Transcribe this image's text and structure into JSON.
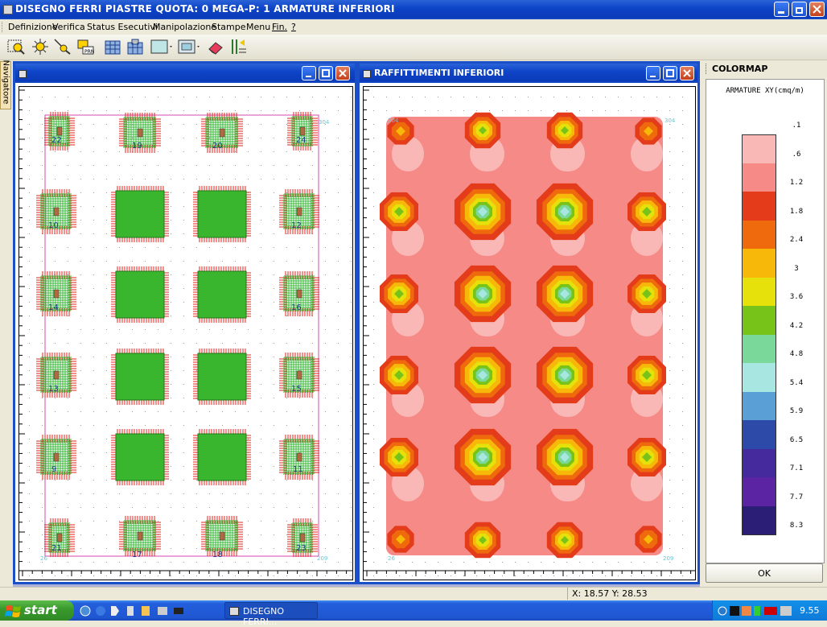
{
  "window": {
    "title": "DISEGNO FERRI PIASTRE QUOTA: 0 MEGA-P: 1 ARMATURE INFERIORI"
  },
  "menu": [
    "Definizione",
    "Verifica",
    "Status Esecutivi",
    "Manipolazione",
    "Stampe",
    "Menu",
    "Fin.",
    "?"
  ],
  "toolbar_icons": [
    "select-rect-icon",
    "select-point-icon",
    "select-line-icon",
    "reinforcement-icon",
    "building-icon",
    "building2-icon",
    "color-box-icon",
    "color-box2-icon",
    "eraser-icon",
    "dimension-icon"
  ],
  "navigator": {
    "label": "Navigatore"
  },
  "left_window": {
    "title": "",
    "plates": [
      {
        "label": "22"
      },
      {
        "label": "19"
      },
      {
        "label": "20"
      },
      {
        "label": "24"
      },
      {
        "label": "10"
      },
      {
        "label": "12"
      },
      {
        "label": "14"
      },
      {
        "label": "16"
      },
      {
        "label": "13"
      },
      {
        "label": "15"
      },
      {
        "label": "9"
      },
      {
        "label": "11"
      },
      {
        "label": "21"
      },
      {
        "label": "17"
      },
      {
        "label": "18"
      },
      {
        "label": "23"
      }
    ],
    "corner_labels": [
      "26",
      "209",
      "304"
    ]
  },
  "right_window": {
    "title": "RAFFITTIMENTI INFERIORI",
    "corner_labels": [
      "304",
      "26",
      "209",
      "304"
    ]
  },
  "colormap": {
    "header": "COLORMAP",
    "title": "ARMATURE XY(cmq/m)",
    "levels": [
      {
        "label": ".1",
        "color": "#f9b8b6"
      },
      {
        "label": ".6",
        "color": "#f58a86"
      },
      {
        "label": "1.2",
        "color": "#e43c1a"
      },
      {
        "label": "1.8",
        "color": "#ee6a0c"
      },
      {
        "label": "2.4",
        "color": "#f7b80a"
      },
      {
        "label": "3",
        "color": "#e6e10a"
      },
      {
        "label": "3.6",
        "color": "#77c31a"
      },
      {
        "label": "4.2",
        "color": "#7ad99a"
      },
      {
        "label": "4.8",
        "color": "#a8e6e2"
      },
      {
        "label": "5.4",
        "color": "#5a9fd6"
      },
      {
        "label": "5.9",
        "color": "#2d4aa8"
      },
      {
        "label": "6.5",
        "color": "#442a9c"
      },
      {
        "label": "7.1",
        "color": "#5a24a2"
      },
      {
        "label": "7.7",
        "color": "#2a1e76"
      },
      {
        "label": "8.3",
        "color": ""
      }
    ],
    "ok_label": "OK"
  },
  "status": {
    "coords": "X: 18.57  Y: 28.53"
  },
  "taskbar": {
    "start_label": "start",
    "task_label": "DISEGNO FERRI...",
    "clock": "9.55"
  }
}
